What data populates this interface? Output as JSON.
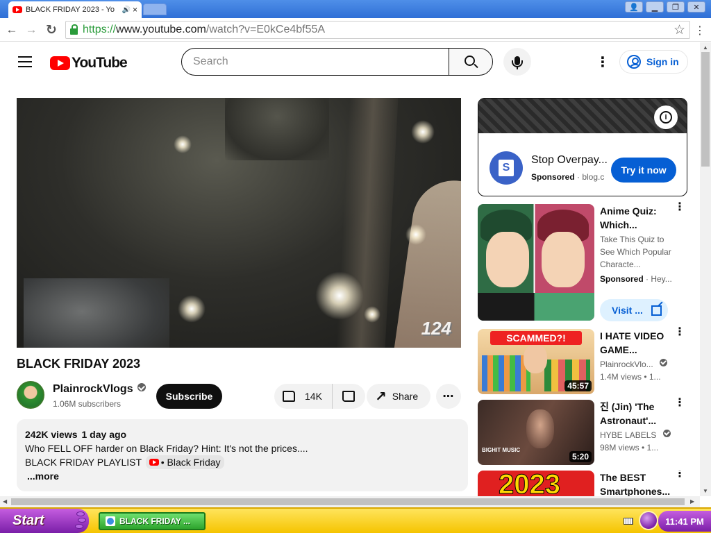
{
  "browser": {
    "tab_title": "BLACK FRIDAY 2023 - Yo",
    "tab_audio_icon": "speaker-icon",
    "tab_close": "×",
    "window_buttons": [
      "user-icon",
      "minimize-icon",
      "restore-icon",
      "close-icon"
    ],
    "nav": {
      "back": "←",
      "forward": "→",
      "reload": "↻"
    },
    "url": {
      "protocol": "https://",
      "host": "www.youtube.com",
      "path": "/watch?v=E0kCe4bf55A"
    },
    "bookmark_icon": "☆",
    "menu_icon": "⋮"
  },
  "yt_header": {
    "logo_text": "YouTube",
    "search_placeholder": "Search",
    "more_icon": "⋮",
    "signin_label": "Sign in"
  },
  "video": {
    "overlay_text": "124",
    "title": "BLACK FRIDAY 2023",
    "channel": "PlainrockVlogs",
    "subscribers": "1.06M subscribers",
    "subscribe_label": "Subscribe",
    "likes": "14K",
    "share_label": "Share",
    "more_icon": "⋯",
    "views": "242K views",
    "age": "1 day ago",
    "description_line1": "Who FELL OFF harder on Black Friday? Hint: It's not the prices....",
    "description_line2": "BLACK FRIDAY PLAYLIST",
    "playlist_link": "• Black Friday",
    "more_label": "...more"
  },
  "ad": {
    "logo_letter": "S",
    "title": "Stop Overpay...",
    "sponsored": "Sponsored",
    "domain": "· blog.c",
    "cta": "Try it now",
    "info_icon": "i"
  },
  "recommendations": [
    {
      "title": "Anime Quiz: Which...",
      "description": "Take This Quiz to See Which Popular Characte...",
      "sponsored": "Sponsored",
      "source": "· Hey...",
      "cta": "Visit ...",
      "menu_icon": "⋮"
    },
    {
      "title": "I HATE VIDEO GAME...",
      "channel": "PlainrockVlo...",
      "meta": "1.4M views • 1...",
      "duration": "45:57",
      "thumb_text": "SCAMMED?!",
      "menu_icon": "⋮"
    },
    {
      "title": "진 (Jin) 'The Astronaut'...",
      "channel": "HYBE LABELS",
      "meta": "98M views • 1...",
      "duration": "5:20",
      "thumb_text": "BIGHIT MUSIC",
      "menu_icon": "⋮"
    },
    {
      "title": "The BEST Smartphones...",
      "thumb_text": "2023",
      "menu_icon": "⋮"
    }
  ],
  "taskbar": {
    "start_label": "Start",
    "task_label": "BLACK FRIDAY ...",
    "clock": "11:41 PM"
  }
}
